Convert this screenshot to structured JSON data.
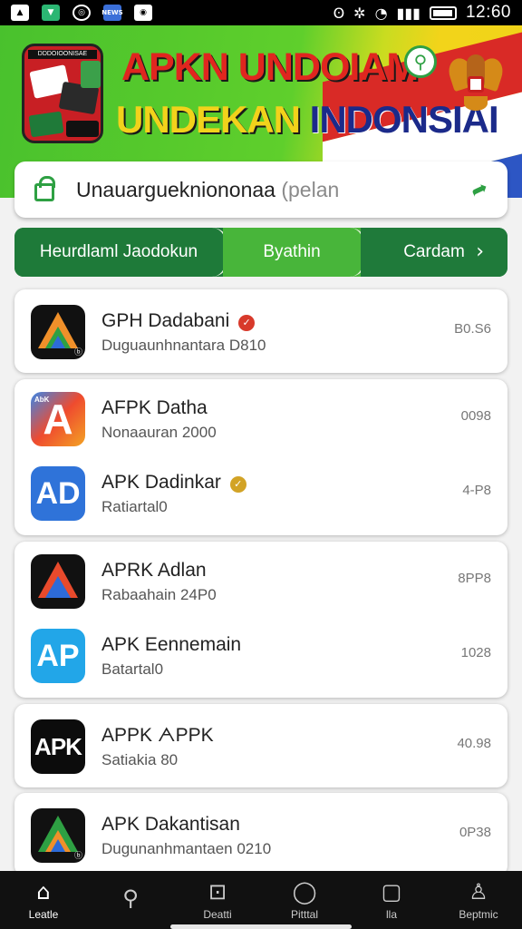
{
  "status_bar": {
    "left_icons": [
      {
        "icon": "mountain-icon",
        "text": "▲"
      },
      {
        "icon": "download-icon",
        "text": "▼"
      },
      {
        "icon": "circle-status-icon",
        "text": "◎"
      },
      {
        "icon": "news-icon",
        "text": "NEWS"
      },
      {
        "icon": "camera-icon",
        "text": "◉"
      }
    ],
    "right_glyphs": [
      "ʘ",
      "✲",
      "◔",
      "▮▮▮"
    ],
    "time": "12:60"
  },
  "banner": {
    "line1": "APKN UNDOIAM",
    "line2_part1": "UNDEKAN ",
    "line2_part2": "INDONSIAI",
    "logo_caption": "DDDOIOONISAE",
    "flag_colors": [
      "#d92a26",
      "#ffffff",
      "#2d56c4"
    ],
    "accent_color": "#49c12d"
  },
  "search": {
    "value": "Unauarguekniononaa",
    "placeholder": "(pelan"
  },
  "tabs": [
    {
      "label": "Heurdlaml Jaodokun"
    },
    {
      "label": "Byathin"
    },
    {
      "label": "Cardam"
    }
  ],
  "apps": [
    {
      "title": "GPH Dadabani",
      "badge": "red",
      "badge_text": "✓",
      "subtitle": "Duguaunhnantara D810",
      "size": "B0.S6",
      "icon": "triangle-logo-icon",
      "icon_text": "",
      "icon_foot": "ⓑ"
    },
    {
      "title": "AFPK Datha",
      "badge": "",
      "badge_text": "",
      "subtitle": "Nonaauran 2000",
      "size": "0098",
      "icon": "letter-a-icon",
      "icon_text": "A",
      "icon_small": "AbK",
      "icon_foot": ""
    },
    {
      "title": "APK Dadinkar",
      "badge": "gold",
      "badge_text": "✓",
      "subtitle": "Ratiartal0",
      "size": "4-P8",
      "icon": "ad-logo-icon",
      "icon_text": "AD",
      "icon_foot": ""
    },
    {
      "title": "APRK Adlan",
      "badge": "",
      "badge_text": "",
      "subtitle": "Rabaahain 24P0",
      "size": "8PP8",
      "icon": "triangle-logo-icon",
      "icon_text": "",
      "icon_foot": ""
    },
    {
      "title": "APK Eennemain",
      "badge": "",
      "badge_text": "",
      "subtitle": "Batartal0",
      "size": "1028",
      "icon": "ap-logo-icon",
      "icon_text": "AP",
      "icon_foot": ""
    },
    {
      "title": "APPK ᗅPPK",
      "badge": "",
      "badge_text": "",
      "subtitle": "Satiakia 80",
      "size": "40.98",
      "icon": "apk-logo-icon",
      "icon_text": "APK",
      "icon_foot": ""
    },
    {
      "title": "APK Dakantisan",
      "badge": "",
      "badge_text": "",
      "subtitle": "Dugunanhmantaen 0210",
      "size": "0P38",
      "icon": "triangle-logo-icon",
      "icon_text": "",
      "icon_foot": "ⓑ"
    }
  ],
  "bottom_nav": [
    {
      "label": "Leatle",
      "icon": "home-icon",
      "glyph": "⌂"
    },
    {
      "label": "",
      "icon": "search-icon",
      "glyph": "⚲"
    },
    {
      "label": "Deatti",
      "icon": "bag-icon",
      "glyph": "⊡"
    },
    {
      "label": "Pitttal",
      "icon": "circle-icon",
      "glyph": "◯"
    },
    {
      "label": "lla",
      "icon": "square-icon",
      "glyph": "▢"
    },
    {
      "label": "Beptmic",
      "icon": "profile-icon",
      "glyph": "♙"
    }
  ]
}
